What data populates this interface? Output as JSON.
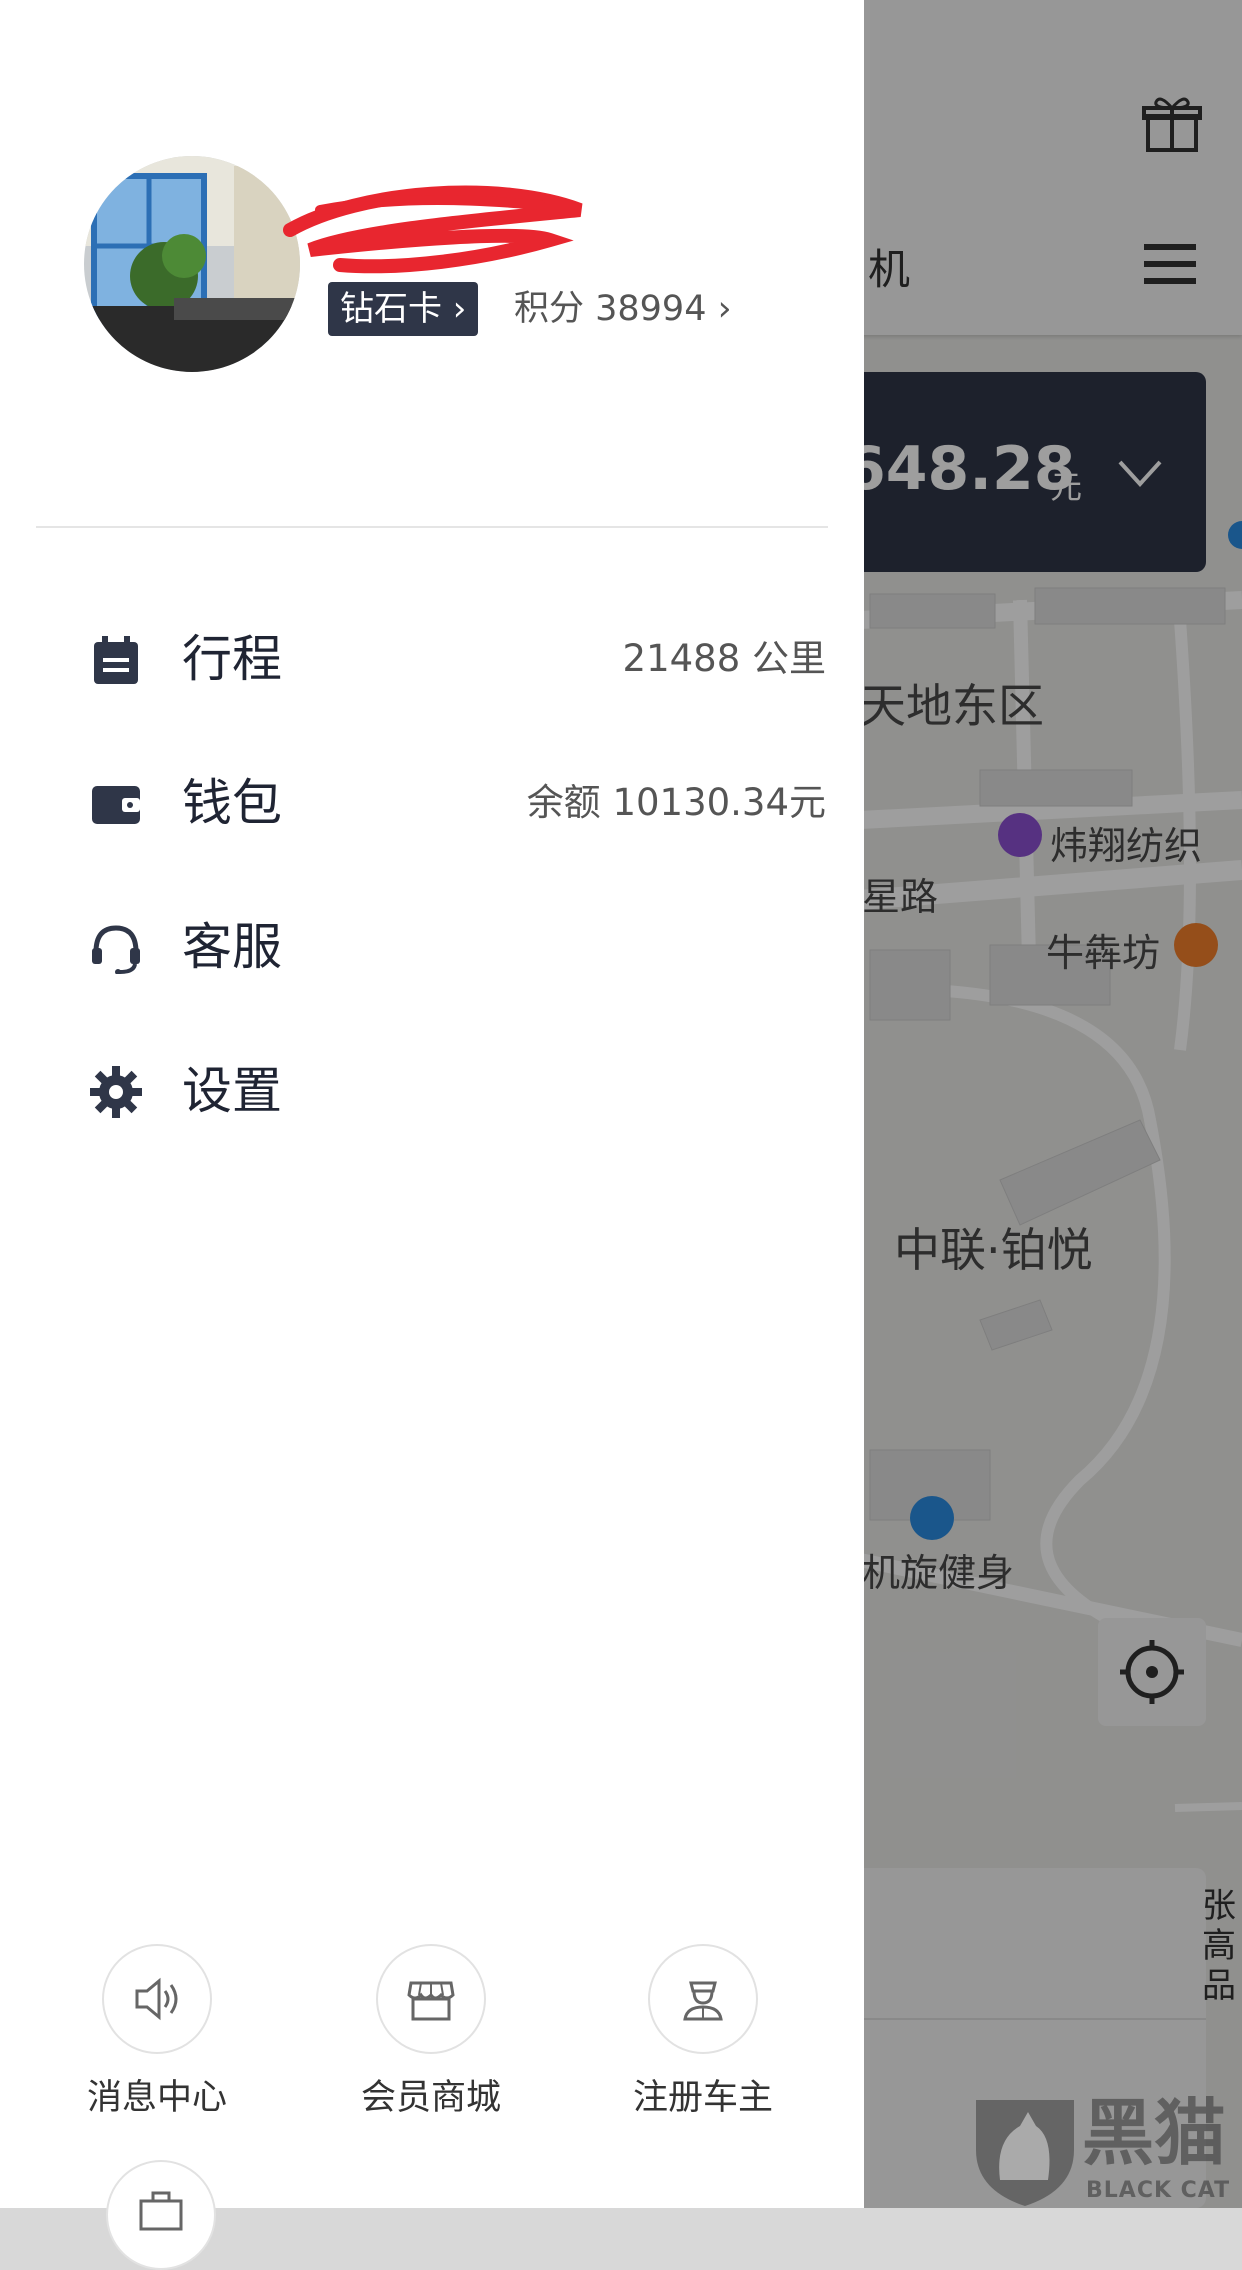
{
  "profile": {
    "card_badge": "钻石卡",
    "points_label": "积分 38994"
  },
  "menu": [
    {
      "label": "行程",
      "value": "21488 公里",
      "icon": "calendar-icon"
    },
    {
      "label": "钱包",
      "value": "余额 10130.34元",
      "icon": "wallet-icon"
    },
    {
      "label": "客服",
      "value": "",
      "icon": "headset-icon"
    },
    {
      "label": "设置",
      "value": "",
      "icon": "gear-icon"
    }
  ],
  "quick_actions": [
    {
      "label": "消息中心",
      "icon": "speaker-icon"
    },
    {
      "label": "会员商城",
      "icon": "store-icon"
    },
    {
      "label": "注册车主",
      "icon": "driver-icon"
    }
  ],
  "background": {
    "header_fragment": "机",
    "fare_amount": "648.28",
    "fare_unit": "元",
    "map_labels": [
      "天地东区",
      "炜翔纺织",
      "星路",
      "牛犇坊",
      "中联·铂悦",
      "机旋健身"
    ],
    "panel_fragment": "张\n高\n品"
  },
  "watermark": {
    "chinese": "黑猫",
    "english": "BLACK CAT"
  },
  "colors": {
    "accent_dark": "#2f3648",
    "dim_overlay": "rgba(0,0,0,0.38)",
    "redaction": "#e8262f"
  }
}
